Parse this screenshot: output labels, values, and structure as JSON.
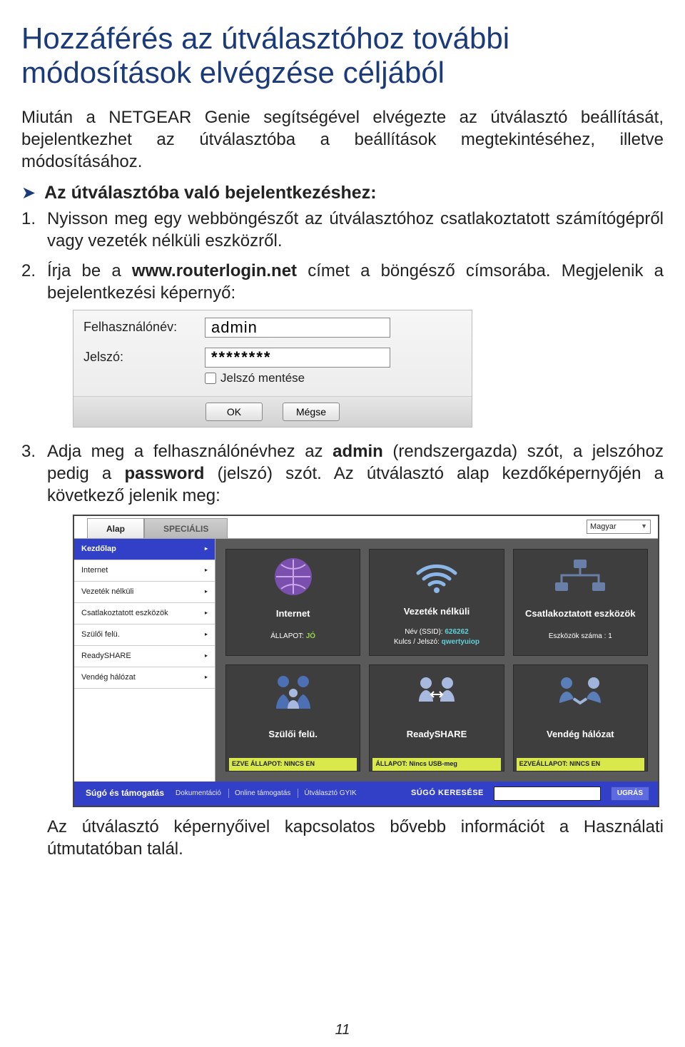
{
  "title": "Hozzáférés az útválasztóhoz további módosítások elvégzése céljából",
  "intro": "Miután a NETGEAR Genie segítségével elvégezte az útválasztó beállítását, bejelentkezhet az útválasztóba a beállítások megtekintéséhez, illetve módosításához.",
  "bullet": "Az útválasztóba való bejelentkezéshez:",
  "step1": "Nyisson meg egy webböngészőt az útválasztóhoz csatlakoztatott számítógépről vagy vezeték nélküli eszközről.",
  "step2_a": "Írja be a ",
  "step2_b": "www.routerlogin.net",
  "step2_c": " címet a böngésző címsorába. Megjelenik a bejelentkezési képernyő:",
  "login": {
    "user_label": "Felhasználónév:",
    "user_value": "admin",
    "pass_label": "Jelszó:",
    "pass_value": "********",
    "save_label": "Jelszó mentése",
    "ok": "OK",
    "cancel": "Mégse"
  },
  "step3_a": "Adja meg a felhasználónévhez az ",
  "step3_b": "admin",
  "step3_c": " (rendszergazda) szót, a jelszóhoz pedig a ",
  "step3_d": "password",
  "step3_e": " (jelszó) szót. Az útválasztó alap kezdőképernyőjén a következő jelenik meg:",
  "genie": {
    "tabs": {
      "basic": "Alap",
      "advanced": "SPECIÁLIS"
    },
    "lang": "Magyar",
    "sidebar": [
      "Kezdőlap",
      "Internet",
      "Vezeték nélküli",
      "Csatlakoztatott eszközök",
      "Szülői felü.",
      "ReadySHARE",
      "Vendég hálózat"
    ],
    "tiles": {
      "internet": {
        "title": "Internet",
        "status_label": "ÁLLAPOT:",
        "status_val": "JÓ"
      },
      "wireless": {
        "title": "Vezeték nélküli",
        "ssid_label": "Név (SSID):",
        "ssid_val": "626262",
        "key_label": "Kulcs / Jelszó:",
        "key_val": "qwertyuiop"
      },
      "attached": {
        "title": "Csatlakoztatott eszközök",
        "count_label": "Eszközök száma :",
        "count_val": "1"
      },
      "parental": {
        "title": "Szülői felü.",
        "status": "EZVE ÁLLAPOT:  NINCS EN"
      },
      "readyshare": {
        "title": "ReadySHARE",
        "status": "ÁLLAPOT:  Nincs USB-meg"
      },
      "guest": {
        "title": "Vendég hálózat",
        "status": "EZVEÁLLAPOT:  NINCS EN"
      }
    },
    "footer": {
      "support": "Súgó és támogatás",
      "links": [
        "Dokumentáció",
        "Online támogatás",
        "Útválasztó GYIK"
      ],
      "search_hint": "SÚGÓ KERESÉSE",
      "go": "UGRÁS"
    }
  },
  "closing": "Az útválasztó képernyőivel kapcsolatos bővebb információt a Használati útmutatóban talál.",
  "page_number": "11"
}
